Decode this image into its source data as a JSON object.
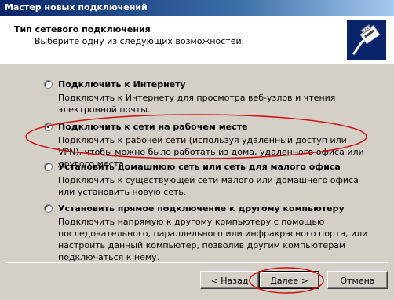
{
  "window": {
    "title": "Мастер новых подключений"
  },
  "header": {
    "title": "Тип сетевого подключения",
    "subtitle": "Выберите одну из следующих возможностей."
  },
  "options": [
    {
      "label": "Подключить к Интернету",
      "description": "Подключить к Интернету для просмотра веб-узлов и чтения электронной почты.",
      "selected": false
    },
    {
      "label": "Подключить к сети на рабочем месте",
      "description": "Подключить к рабочей сети (используя удаленный доступ или VPN), чтобы можно было работать из дома, удаленного офиса или другого места.",
      "selected": true
    },
    {
      "label": "Установить домашнюю сеть или сеть для малого офиса",
      "description": "Подключить к существующей сети малого или домашнего офиса или установить новую сеть.",
      "selected": false
    },
    {
      "label": "Установить прямое подключение к другому компьютеру",
      "description": "Подключить напрямую к другому компьютеру с помощью последовательного, параллельного или инфракрасного порта, или настроить данный компьютер, позволив другим компьютерам подключаться к нему.",
      "selected": false
    }
  ],
  "buttons": {
    "back": "< Назад",
    "next": "Далее >",
    "cancel": "Отмена"
  },
  "colors": {
    "highlight_ellipse": "#d01010",
    "title_bar": "#0a246a",
    "header_icon_bg": "#0a246a"
  }
}
